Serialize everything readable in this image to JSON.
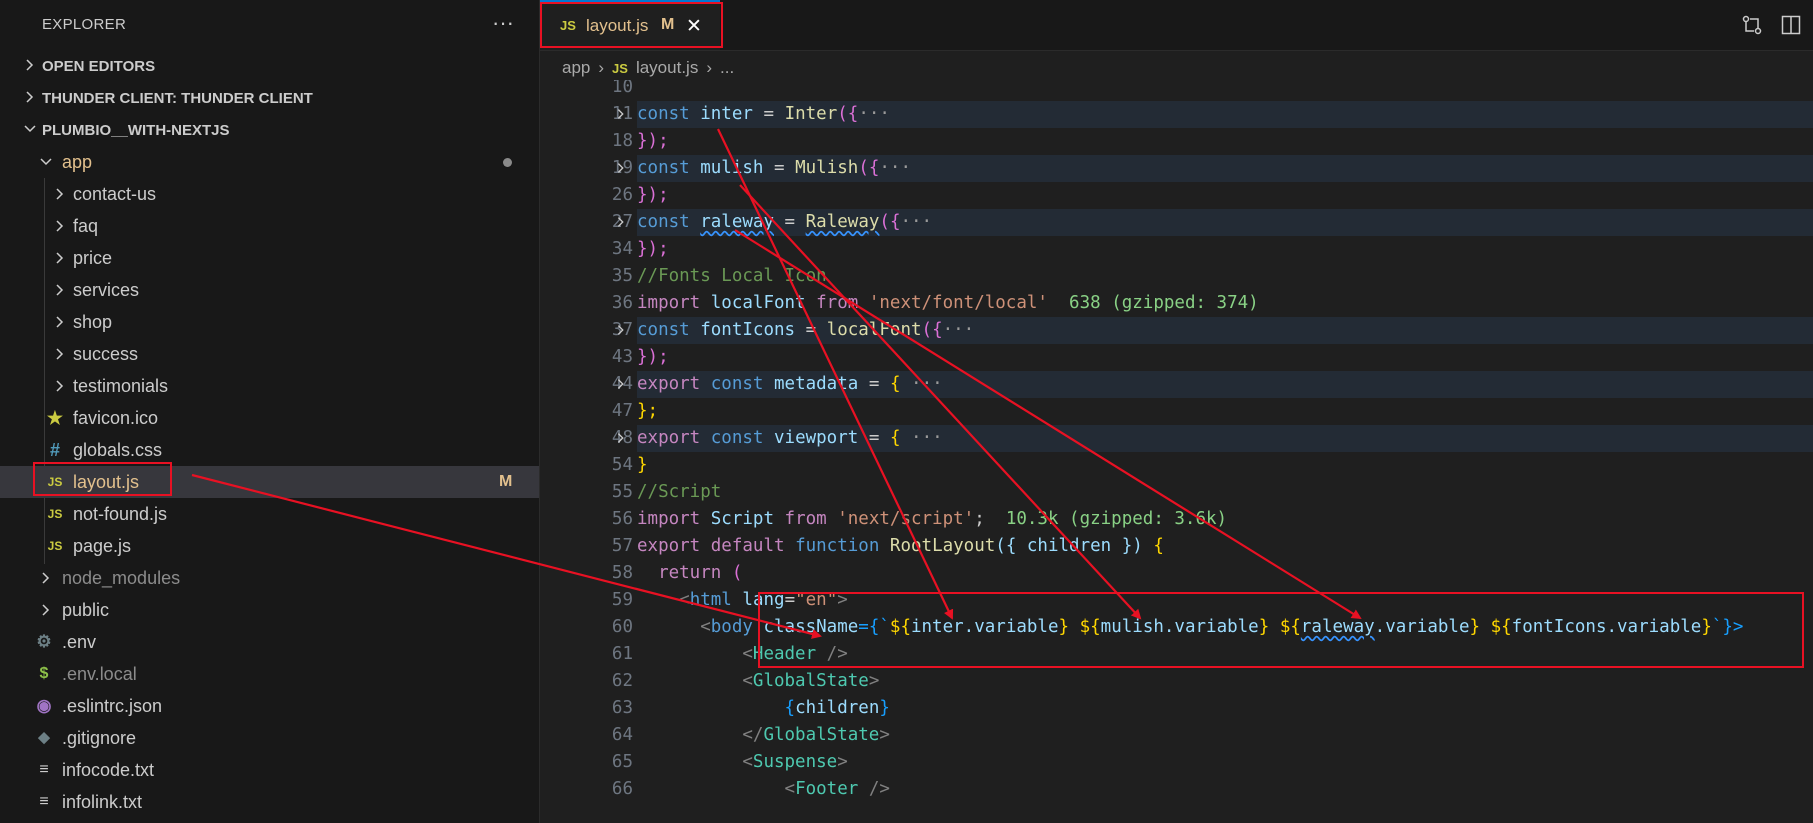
{
  "explorer": {
    "title": "EXPLORER",
    "more_label": "···",
    "sections": {
      "open_editors": "OPEN EDITORS",
      "thunder_client": "THUNDER CLIENT: THUNDER CLIENT",
      "project": "PLUMBIO__WITH-NEXTJS"
    },
    "app_folder": "app",
    "app_children": [
      "contact-us",
      "faq",
      "price",
      "services",
      "shop",
      "success",
      "testimonials"
    ],
    "app_files": [
      {
        "name": "favicon.ico",
        "icon": "star-icon",
        "icon_color": "#cbcb41"
      },
      {
        "name": "globals.css",
        "icon": "hash-icon",
        "icon_color": "#519aba"
      },
      {
        "name": "layout.js",
        "icon": "js-icon",
        "icon_color": "#cbcb41",
        "badge": "M"
      },
      {
        "name": "not-found.js",
        "icon": "js-icon",
        "icon_color": "#cbcb41"
      },
      {
        "name": "page.js",
        "icon": "js-icon",
        "icon_color": "#cbcb41"
      }
    ],
    "root_folders": [
      "node_modules",
      "public"
    ],
    "root_files": [
      ".env",
      ".env.local",
      ".eslintrc.json",
      ".gitignore",
      "infocode.txt",
      "infolink.txt"
    ]
  },
  "tab": {
    "icon_text": "JS",
    "name": "layout.js",
    "modified": "M",
    "close": "✕"
  },
  "breadcrumb": [
    "app",
    "layout.js",
    "..."
  ],
  "code_lines": [
    {
      "n": "10"
    },
    {
      "n": "11"
    },
    {
      "n": "18"
    },
    {
      "n": "19"
    },
    {
      "n": "26"
    },
    {
      "n": "27"
    },
    {
      "n": "34"
    },
    {
      "n": "35"
    },
    {
      "n": "36"
    },
    {
      "n": "37"
    },
    {
      "n": "43"
    },
    {
      "n": "44"
    },
    {
      "n": "47"
    },
    {
      "n": "48"
    },
    {
      "n": "54"
    },
    {
      "n": "55"
    },
    {
      "n": "56"
    },
    {
      "n": "57"
    },
    {
      "n": "58"
    },
    {
      "n": "59"
    },
    {
      "n": "60"
    },
    {
      "n": "61"
    },
    {
      "n": "62"
    },
    {
      "n": "63"
    },
    {
      "n": "64"
    },
    {
      "n": "65"
    },
    {
      "n": "66"
    }
  ],
  "code_text": {
    "l11": [
      "const",
      "inter",
      "=",
      "Inter",
      "({",
      "···"
    ],
    "l18": "});",
    "l19": [
      "const",
      "mulish",
      "=",
      "Mulish",
      "({",
      "···"
    ],
    "l26": "});",
    "l27": [
      "const",
      "raleway",
      "=",
      "Raleway",
      "({",
      "···"
    ],
    "l34": "});",
    "l35": "//Fonts Local Icon",
    "l36": [
      "import",
      "localFont",
      "from",
      "'next/font/local'",
      "638 (gzipped: 374)"
    ],
    "l37": [
      "const",
      "fontIcons",
      "=",
      "localFont",
      "({",
      "···"
    ],
    "l43": "});",
    "l44": [
      "export",
      "const",
      "metadata",
      "=",
      "{",
      "···"
    ],
    "l47": "};",
    "l48": [
      "export",
      "const",
      "viewport",
      "=",
      "{",
      "···"
    ],
    "l54": "}",
    "l55": "//Script",
    "l56": [
      "import",
      "Script",
      "from",
      "'next/script'",
      "10.3k (gzipped: 3.6k)"
    ],
    "l57": [
      "export",
      "default",
      "function",
      "RootLayout",
      "({ children })",
      "{"
    ],
    "l58": [
      "return",
      "("
    ],
    "l59": [
      "<",
      "html",
      "lang",
      "=",
      "\"en\"",
      ">"
    ],
    "l60": [
      "<",
      "body",
      "className",
      "={`",
      "${",
      "inter",
      ".variable",
      "}",
      "${",
      "mulish",
      ".variable",
      "}",
      "${",
      "raleway",
      ".variable",
      "}",
      "${",
      "fontIcons",
      ".variable",
      "}",
      "`}>"
    ],
    "l61": [
      "<",
      "Header",
      "/>"
    ],
    "l62": [
      "<",
      "GlobalState",
      ">"
    ],
    "l63": [
      "{",
      "children",
      "}"
    ],
    "l64": [
      "</",
      "GlobalState",
      ">"
    ],
    "l65": [
      "<",
      "Suspense",
      ">"
    ],
    "l66": [
      "<",
      "Footer",
      "/>"
    ]
  },
  "colors": {
    "annotation": "#e81123",
    "accent": "#0078d4",
    "modified": "#e2c08d"
  }
}
